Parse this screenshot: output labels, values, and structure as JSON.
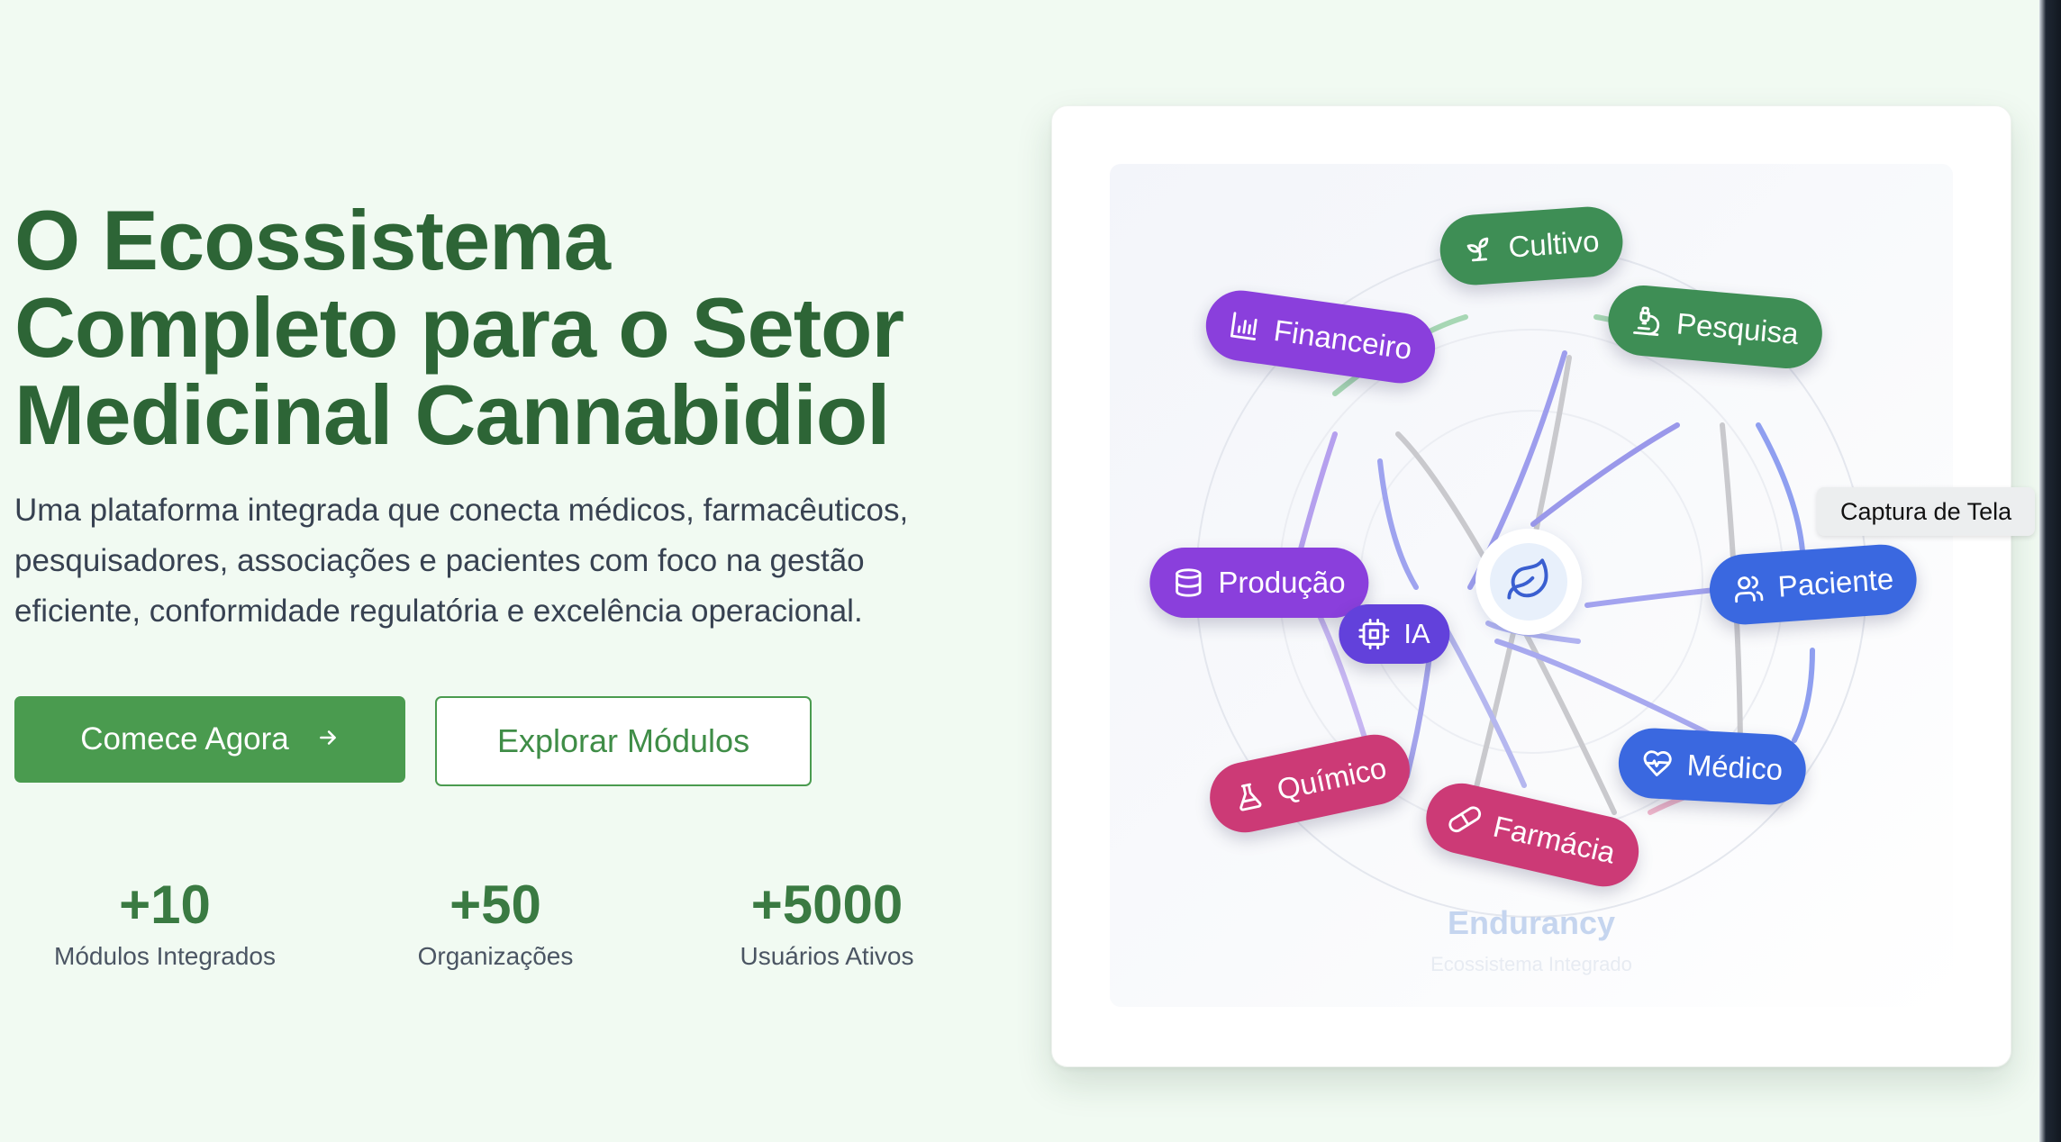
{
  "hero": {
    "title_line1": "O Ecossistema",
    "title_line2": "Completo para o Setor",
    "title_line3": "Medicinal Cannabidiol",
    "subtitle": "Uma plataforma integrada que conecta médicos, farmacêuticos, pesquisadores, associações e pacientes com foco na gestão eficiente, conformidade regulatória e excelência operacional.",
    "primary_button": "Comece Agora",
    "secondary_button": "Explorar Módulos"
  },
  "stats": [
    {
      "value": "+10",
      "label": "Módulos Integrados"
    },
    {
      "value": "+50",
      "label": "Organizações"
    },
    {
      "value": "+5000",
      "label": "Usuários Ativos"
    }
  ],
  "ecosystem": {
    "brand": "Endurancy",
    "tagline": "Ecossistema Integrado",
    "center_icon": "leaf-icon",
    "nodes": {
      "cultivo": {
        "label": "Cultivo",
        "icon": "sprout-icon",
        "color": "#3e8e55"
      },
      "pesquisa": {
        "label": "Pesquisa",
        "icon": "microscope-icon",
        "color": "#3e8e55"
      },
      "financeiro": {
        "label": "Financeiro",
        "icon": "bar-chart-icon",
        "color": "#8a3fdc"
      },
      "producao": {
        "label": "Produção",
        "icon": "database-icon",
        "color": "#8a3fdc"
      },
      "ia": {
        "label": "IA",
        "icon": "cpu-icon",
        "color": "#6241db"
      },
      "paciente": {
        "label": "Paciente",
        "icon": "users-icon",
        "color": "#3a68e0"
      },
      "medico": {
        "label": "Médico",
        "icon": "heart-pulse-icon",
        "color": "#3a68e0"
      },
      "quimico": {
        "label": "Químico",
        "icon": "flask-icon",
        "color": "#cc3a76"
      },
      "farmacia": {
        "label": "Farmácia",
        "icon": "pill-icon",
        "color": "#cc3a76"
      }
    }
  },
  "tooltip": "Captura de Tela",
  "colors": {
    "title": "#2d6536",
    "primary": "#4a9b4f",
    "background": "#f1faf2"
  }
}
